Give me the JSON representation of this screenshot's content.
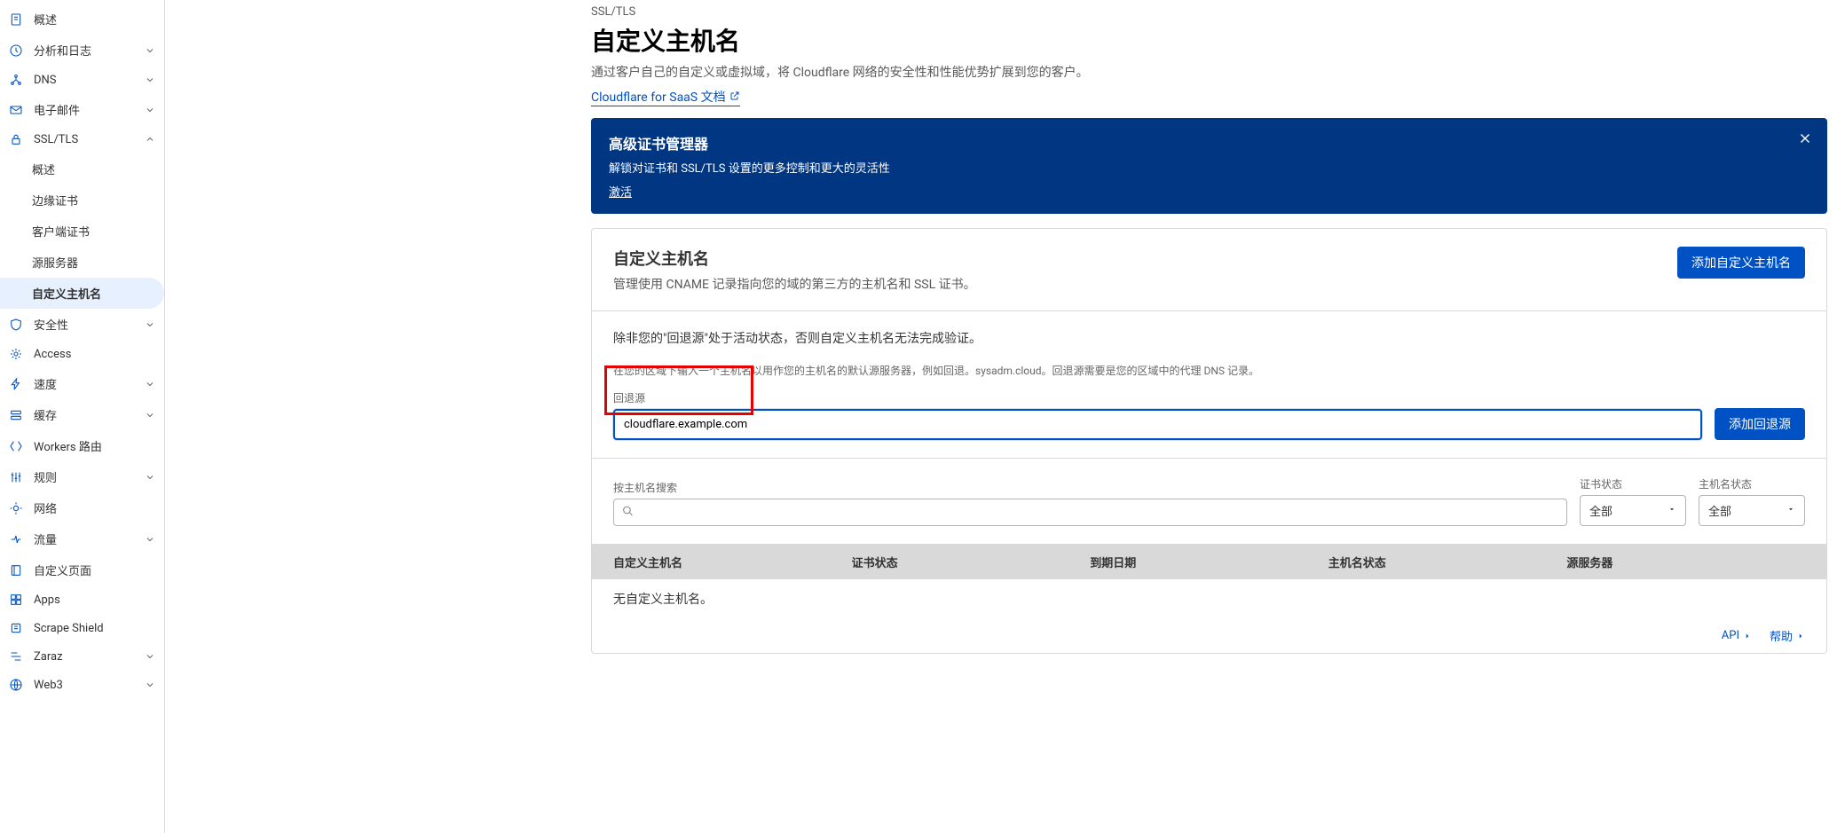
{
  "sidebar": {
    "items": [
      {
        "icon": "file",
        "label": "概述",
        "chevron": false
      },
      {
        "icon": "clock",
        "label": "分析和日志",
        "chevron": true
      },
      {
        "icon": "dns",
        "label": "DNS",
        "chevron": true
      },
      {
        "icon": "mail",
        "label": "电子邮件",
        "chevron": true
      },
      {
        "icon": "lock",
        "label": "SSL/TLS",
        "chevron": true,
        "open": true
      },
      {
        "sub": true,
        "label": "概述"
      },
      {
        "sub": true,
        "label": "边缘证书"
      },
      {
        "sub": true,
        "label": "客户端证书"
      },
      {
        "sub": true,
        "label": "源服务器"
      },
      {
        "sub": true,
        "label": "自定义主机名",
        "active": true
      },
      {
        "icon": "shield",
        "label": "安全性",
        "chevron": true
      },
      {
        "icon": "access",
        "label": "Access"
      },
      {
        "icon": "bolt",
        "label": "速度",
        "chevron": true
      },
      {
        "icon": "cache",
        "label": "缓存",
        "chevron": true
      },
      {
        "icon": "workers",
        "label": "Workers 路由"
      },
      {
        "icon": "rules",
        "label": "规则",
        "chevron": true
      },
      {
        "icon": "network",
        "label": "网络"
      },
      {
        "icon": "traffic",
        "label": "流量",
        "chevron": true
      },
      {
        "icon": "pages",
        "label": "自定义页面"
      },
      {
        "icon": "apps",
        "label": "Apps"
      },
      {
        "icon": "scrape",
        "label": "Scrape Shield"
      },
      {
        "icon": "zaraz",
        "label": "Zaraz",
        "chevron": true
      },
      {
        "icon": "web3",
        "label": "Web3",
        "chevron": true
      }
    ]
  },
  "breadcrumb": "SSL/TLS",
  "page_title": "自定义主机名",
  "page_desc": "通过客户自己的自定义或虚拟域，将 Cloudflare 网络的安全性和性能优势扩展到您的客户。",
  "doc_link": "Cloudflare for SaaS 文档",
  "banner": {
    "title": "高级证书管理器",
    "desc": "解锁对证书和 SSL/TLS 设置的更多控制和更大的灵活性",
    "link": "激活"
  },
  "section1": {
    "title": "自定义主机名",
    "subtitle": "管理使用 CNAME 记录指向您的域的第三方的主机名和 SSL 证书。",
    "button": "添加自定义主机名"
  },
  "section2": {
    "warning": "除非您的\"回退源\"处于活动状态，否则自定义主机名无法完成验证。",
    "hint": "在您的区域下输入一个主机名以用作您的主机名的默认源服务器，例如回退。sysadm.cloud。回退源需要是您的区域中的代理 DNS 记录。",
    "label": "回退源",
    "value": "cloudflare.example.com",
    "button": "添加回退源"
  },
  "section3": {
    "search_label": "按主机名搜索",
    "cert_status_label": "证书状态",
    "host_status_label": "主机名状态",
    "all": "全部"
  },
  "table": {
    "columns": [
      "自定义主机名",
      "证书状态",
      "到期日期",
      "主机名状态",
      "源服务器"
    ],
    "empty": "无自定义主机名。"
  },
  "footer": {
    "api": "API",
    "help": "帮助"
  }
}
